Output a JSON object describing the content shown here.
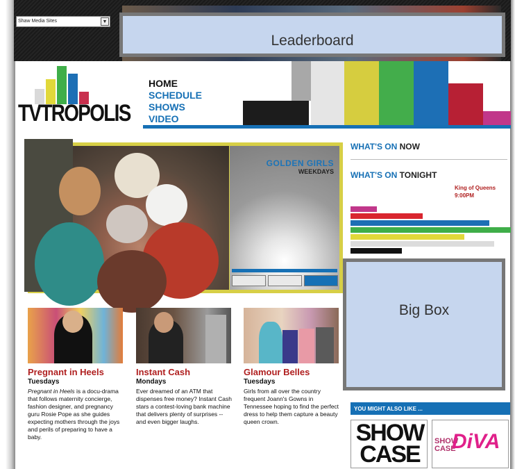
{
  "topbar": {
    "site_select": "Shaw Media Sites",
    "leaderboard_label": "Leaderboard"
  },
  "logo": {
    "text": "TVTROPOLIS",
    "bar_colors": [
      "#d9d9d9",
      "#e1d83a",
      "#3fae49",
      "#1d6fb5",
      "#c8304e"
    ]
  },
  "nav": {
    "items": [
      "HOME",
      "SCHEDULE",
      "SHOWS",
      "VIDEO"
    ],
    "accent": "#1670b5"
  },
  "feature": {
    "show_title": "GOLDEN GIRLS",
    "show_time": "WEEKDAYS",
    "slide_count": 3,
    "active_slide": 3
  },
  "whats_on": {
    "now_prefix": "WHAT'S ON",
    "now_suffix": "NOW",
    "tonight_prefix": "WHAT'S ON",
    "tonight_suffix": "TONIGHT",
    "tonight_show": "King of Queens",
    "tonight_time": "9:00PM"
  },
  "bigbox_label": "Big Box",
  "you_might_also_like": {
    "heading": "YOU MIGHT ALSO LIKE ...",
    "items": [
      {
        "logo_line1": "SHOW",
        "logo_line2": "CASE"
      },
      {
        "logo_prefix": "SHOW CASE",
        "logo_word": "DiVA"
      }
    ]
  },
  "cards": [
    {
      "title": "Pregnant in Heels",
      "day": "Tuesdays",
      "desc_italic": "Pregnant in Heels",
      "desc": " is a docu-drama that follows maternity concierge, fashion designer, and pregnancy guru Rosie Pope as she guides expecting mothers through the joys and perils of preparing to have a baby."
    },
    {
      "title": "Instant Cash",
      "day": "Mondays",
      "desc_italic": "",
      "desc": "Ever dreamed of an ATM that dispenses free money? Instant Cash stars a contest-loving bank machine that delivers plenty of surprises -- and even bigger laughs."
    },
    {
      "title": "Glamour Belles",
      "day": "Tuesdays",
      "desc_italic": "",
      "desc": "Girls from all over the country frequent Joann's Gowns in Tennessee hoping to find the perfect dress to help them capture a beauty queen crown."
    }
  ],
  "colors": {
    "brand_blue": "#1670b5",
    "title_red": "#b02020",
    "feature_border": "#d7cf46",
    "placeholder_blue": "#c6d6ee"
  }
}
